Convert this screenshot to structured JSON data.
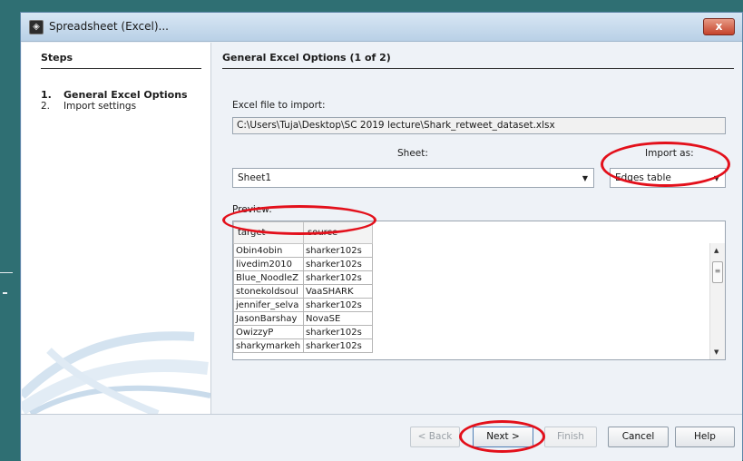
{
  "window": {
    "title": "Spreadsheet (Excel)...",
    "close_label": "x"
  },
  "steps": {
    "header": "Steps",
    "items": [
      {
        "num": "1.",
        "label": "General Excel Options"
      },
      {
        "num": "2.",
        "label": "Import settings"
      }
    ]
  },
  "main": {
    "title": "General Excel Options (1 of 2)",
    "file_label": "Excel file to import:",
    "file_value": "C:\\Users\\Tuja\\Desktop\\SC 2019 lecture\\Shark_retweet_dataset.xlsx",
    "sheet_label": "Sheet:",
    "sheet_value": "Sheet1",
    "import_as_label": "Import as:",
    "import_as_value": "Edges table",
    "preview_label": "Preview:"
  },
  "preview": {
    "columns": [
      "target",
      "source"
    ],
    "rows": [
      [
        "Obin4obin",
        "sharker102s"
      ],
      [
        "livedim2010",
        "sharker102s"
      ],
      [
        "Blue_NoodleZ",
        "sharker102s"
      ],
      [
        "stonekoldsoul",
        "VaaSHARK"
      ],
      [
        "jennifer_selva",
        "sharker102s"
      ],
      [
        "JasonBarshay",
        "NovaSE"
      ],
      [
        "OwizzyP",
        "sharker102s"
      ],
      [
        "sharkymarkeh",
        "sharker102s"
      ]
    ]
  },
  "buttons": {
    "back": "< Back",
    "next": "Next >",
    "finish": "Finish",
    "cancel": "Cancel",
    "help": "Help"
  },
  "colors": {
    "annotation": "#e3101b",
    "titlebar": "#c9dcef",
    "background": "#2f6f73"
  }
}
